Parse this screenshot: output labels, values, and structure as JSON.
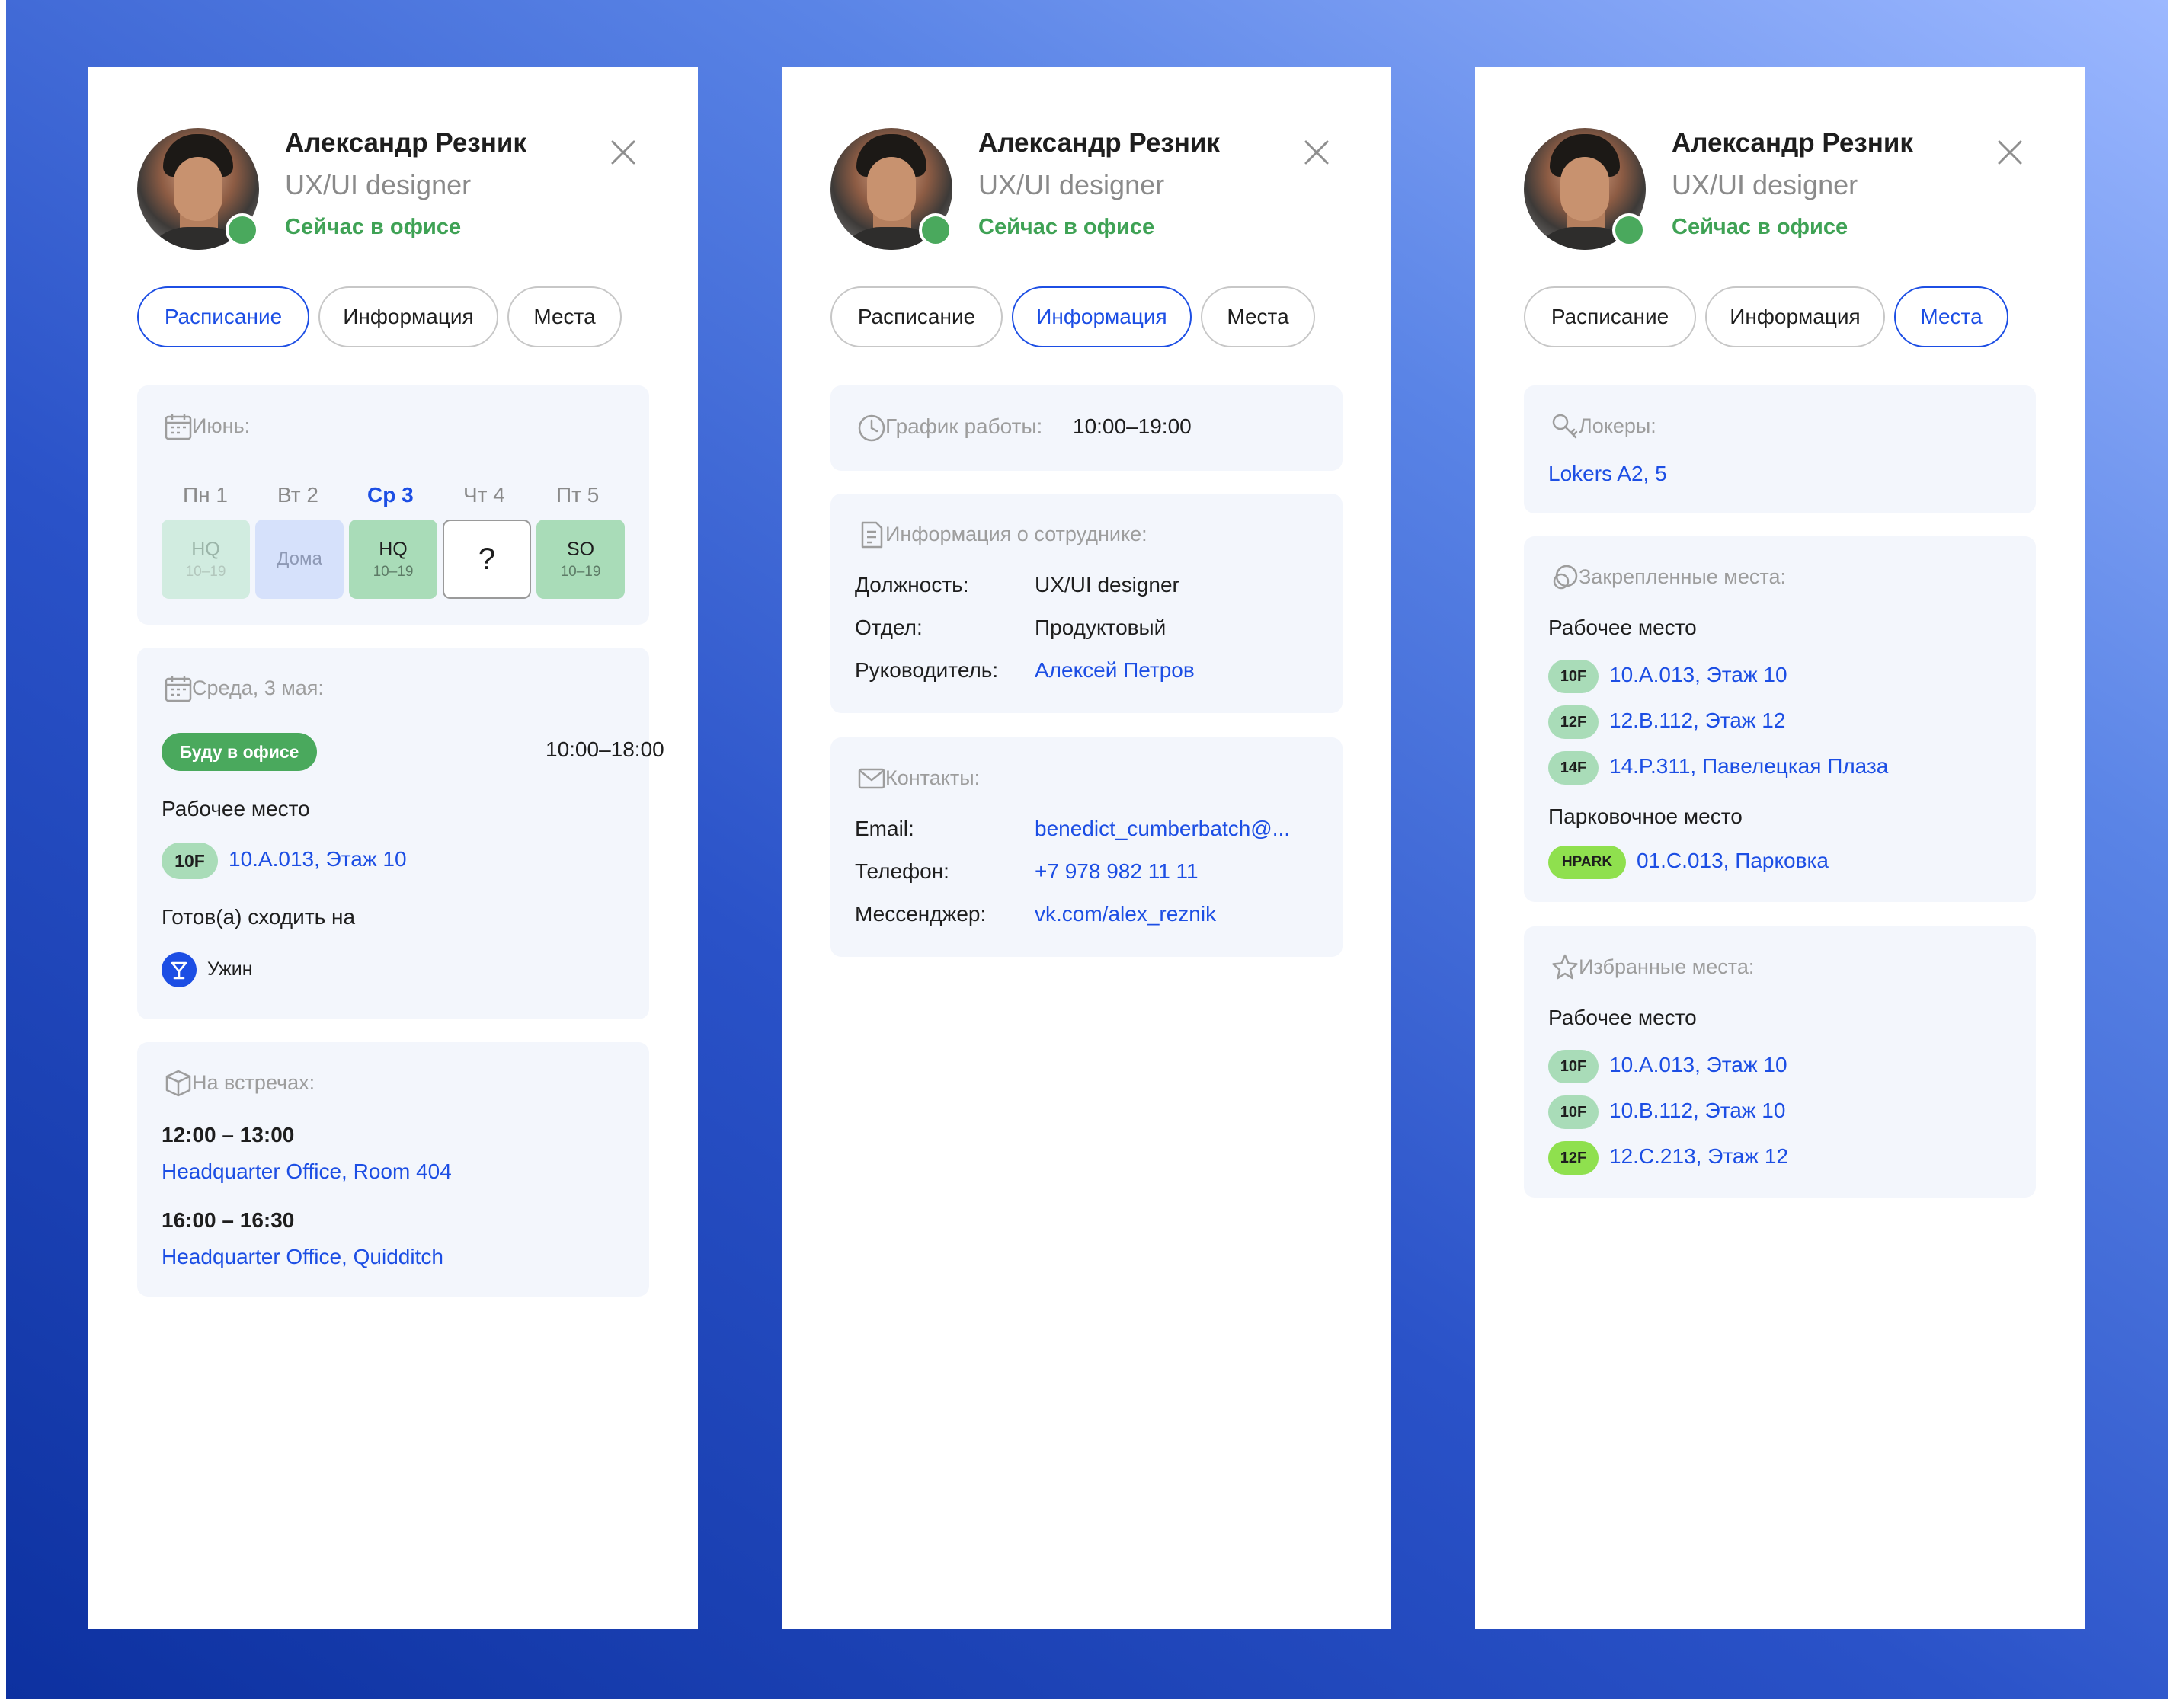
{
  "colors": {
    "accent": "#1c4ee4",
    "online": "#4aa95d",
    "green_tag": "#a9dcb8",
    "lime_tag": "#8fe04e"
  },
  "profile": {
    "name": "Александр Резник",
    "role": "UX/UI designer",
    "status": "Сейчас в офисе"
  },
  "tabs": [
    "Расписание",
    "Информация",
    "Места"
  ],
  "schedule": {
    "month_label": "Июнь:",
    "days": [
      {
        "label": "Пн 1",
        "place": "HQ",
        "time": "10–19"
      },
      {
        "label": "Вт 2",
        "place": "Дома",
        "time": ""
      },
      {
        "label": "Ср 3",
        "place": "HQ",
        "time": "10–19"
      },
      {
        "label": "Чт 4",
        "place": "?",
        "time": ""
      },
      {
        "label": "Пт 5",
        "place": "SO",
        "time": "10–19"
      }
    ],
    "day_card": {
      "title": "Среда, 3 мая:",
      "badge": "Буду в офисе",
      "time": "10:00–18:00",
      "workplace_label": "Рабочее место",
      "workplace_tag": "10F",
      "workplace_link": "10.A.013, Этаж 10",
      "ready_label": "Готов(а) сходить на",
      "activity": "Ужин"
    },
    "meetings": {
      "title": "На встречах:",
      "items": [
        {
          "time": "12:00 – 13:00",
          "place": "Headquarter Office, Room 404"
        },
        {
          "time": "16:00 – 16:30",
          "place": "Headquarter Office, Quidditch"
        }
      ]
    }
  },
  "info": {
    "work_hours_label": "График работы:",
    "work_hours_value": "10:00–19:00",
    "employee_title": "Информация о сотруднике:",
    "employee_rows": [
      {
        "k": "Должность:",
        "v": "UX/UI designer"
      },
      {
        "k": "Отдел:",
        "v": "Продуктовый"
      },
      {
        "k": "Руководитель:",
        "v": "Алексей Петров"
      }
    ],
    "contacts_title": "Контакты:",
    "contact_rows": [
      {
        "k": "Email:",
        "v": "benedict_cumberbatch@..."
      },
      {
        "k": "Телефон:",
        "v": "+7 978 982 11 11"
      },
      {
        "k": "Мессенджер:",
        "v": "vk.com/alex_reznik"
      }
    ]
  },
  "places": {
    "lockers_title": "Локеры:",
    "lockers_value": "Lokers A2, 5",
    "pinned_title": "Закрепленные места:",
    "pinned_workplace_label": "Рабочее место",
    "pinned_workplaces": [
      {
        "tag": "10F",
        "text": "10.A.013, Этаж 10"
      },
      {
        "tag": "12F",
        "text": "12.B.112, Этаж 12"
      },
      {
        "tag": "14F",
        "text": "14.P.311, Павелецкая Плаза"
      }
    ],
    "parking_label": "Парковочное место",
    "parking": {
      "tag": "HPARK",
      "text": "01.C.013, Парковка"
    },
    "fav_title": "Избранные места:",
    "fav_workplace_label": "Рабочее место",
    "favorites": [
      {
        "tag": "10F",
        "text": "10.A.013, Этаж 10"
      },
      {
        "tag": "10F",
        "text": "10.B.112, Этаж 10"
      },
      {
        "tag": "12F",
        "text": "12.C.213, Этаж 12"
      }
    ]
  }
}
